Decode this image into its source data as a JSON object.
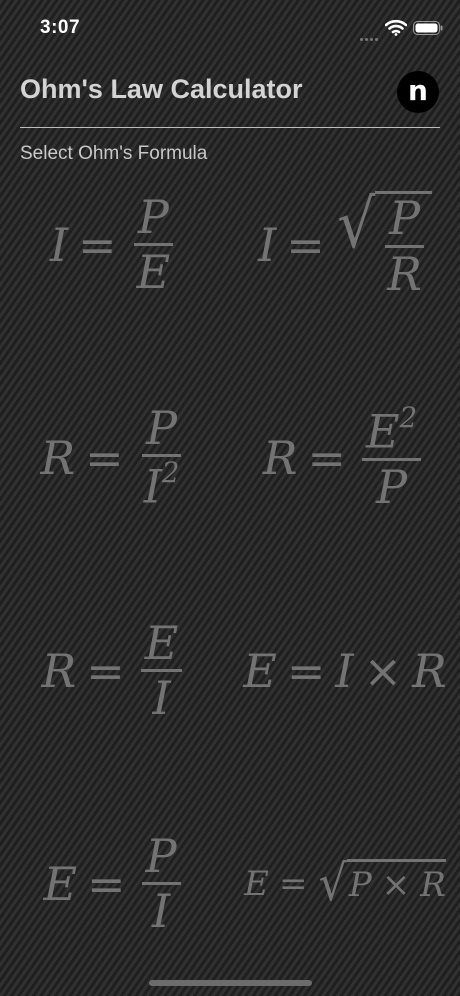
{
  "status": {
    "time": "3:07"
  },
  "header": {
    "title": "Ohm's Law Calculator",
    "logo_glyph": "n"
  },
  "section": {
    "label": "Select Ohm's Formula"
  },
  "formulas": [
    {
      "lhs": "I",
      "op": "=",
      "num": "P",
      "den": "E"
    },
    {
      "lhs": "I",
      "op": "=",
      "sqrt_num": "P",
      "sqrt_den": "R"
    },
    {
      "lhs": "R",
      "op": "=",
      "num": "P",
      "den_base": "I",
      "den_exp": "2"
    },
    {
      "lhs": "R",
      "op": "=",
      "num_base": "E",
      "num_exp": "2",
      "den": "P"
    },
    {
      "lhs": "R",
      "op": "=",
      "num": "E",
      "den": "I"
    },
    {
      "lhs": "E",
      "op": "=",
      "a": "I",
      "times": "×",
      "b": "R"
    },
    {
      "lhs": "E",
      "op": "=",
      "num": "P",
      "den": "I"
    },
    {
      "lhs": "E",
      "op": "=",
      "a": "P",
      "times": "×",
      "b": "R"
    }
  ],
  "colors": {
    "background": "#262626",
    "formula": "#737373",
    "title": "#d4d4d4"
  }
}
